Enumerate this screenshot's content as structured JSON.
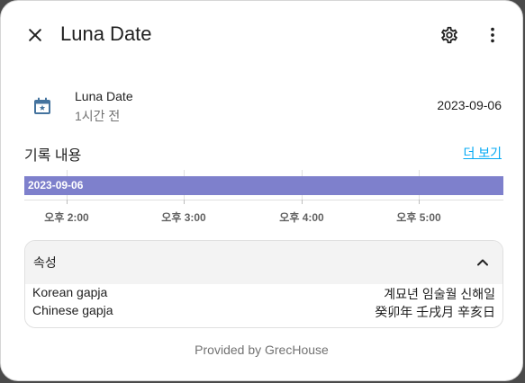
{
  "header": {
    "title": "Luna Date",
    "close_icon": "close-icon",
    "settings_icon": "gear-icon",
    "more_icon": "more-vertical-icon"
  },
  "entity": {
    "icon": "calendar-star-icon",
    "name": "Luna Date",
    "last_changed": "1시간 전",
    "state": "2023-09-06"
  },
  "history": {
    "title": "기록 내용",
    "more_label": "더 보기",
    "bar_label": "2023-09-06",
    "bar_color": "#7e80cc",
    "time_labels": [
      "오후 2:00",
      "오후 3:00",
      "오후 4:00",
      "오후 5:00"
    ]
  },
  "attributes": {
    "title": "속성",
    "rows": [
      {
        "key": "Korean gapja",
        "value": "계묘년 임술월 신해일"
      },
      {
        "key": "Chinese gapja",
        "value": "癸卯年 壬戌月 辛亥日"
      }
    ]
  },
  "footer": {
    "text": "Provided by GrecHouse"
  },
  "colors": {
    "accent": "#03a9f4",
    "icon_blue": "#44739e"
  }
}
